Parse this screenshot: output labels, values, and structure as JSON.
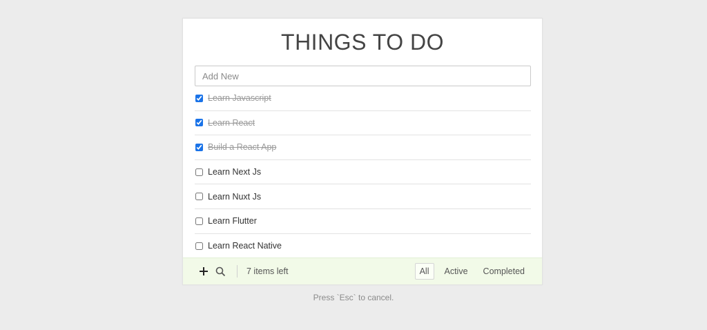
{
  "app": {
    "title": "THINGS TO DO",
    "accent_color": "#1a73e8",
    "footer_color": "#f2fae8"
  },
  "input": {
    "placeholder": "Add New",
    "value": ""
  },
  "todos": [
    {
      "label": "Learn Javascript",
      "done": true
    },
    {
      "label": "Learn React",
      "done": true
    },
    {
      "label": "Build a React App",
      "done": true
    },
    {
      "label": "Learn Next Js",
      "done": false
    },
    {
      "label": "Learn Nuxt Js",
      "done": false
    },
    {
      "label": "Learn Flutter",
      "done": false
    },
    {
      "label": "Learn React Native",
      "done": false
    }
  ],
  "footer": {
    "add_icon": "plus-icon",
    "search_icon": "search-icon",
    "count_text": "7 items left",
    "filters": [
      {
        "label": "All",
        "active": true
      },
      {
        "label": "Active",
        "active": false
      },
      {
        "label": "Completed",
        "active": false
      }
    ]
  },
  "hint": "Press `Esc` to cancel."
}
